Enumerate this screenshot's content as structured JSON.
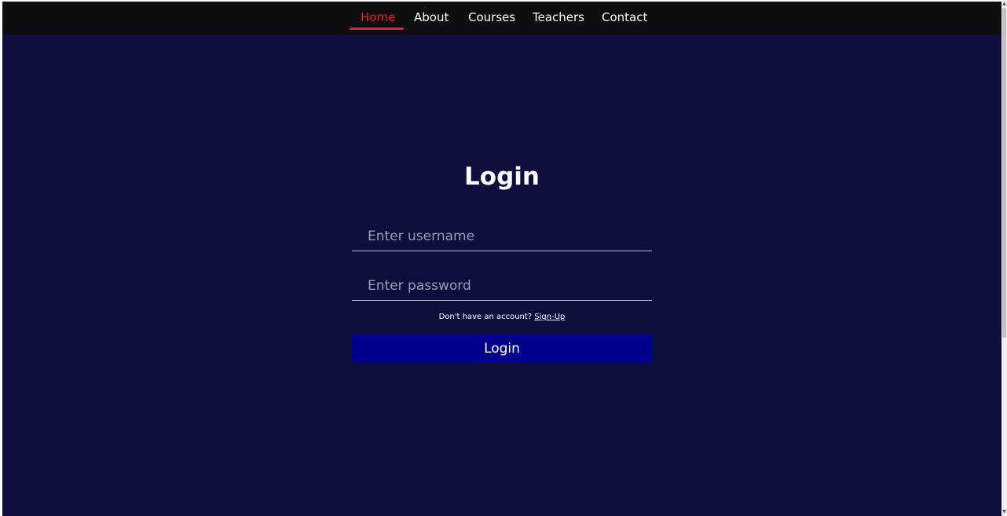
{
  "nav": {
    "items": [
      {
        "label": "Home",
        "active": true
      },
      {
        "label": "About",
        "active": false
      },
      {
        "label": "Courses",
        "active": false
      },
      {
        "label": "Teachers",
        "active": false
      },
      {
        "label": "Contact",
        "active": false
      }
    ]
  },
  "login": {
    "title": "Login",
    "username_placeholder": "Enter username",
    "username_value": "",
    "password_placeholder": "Enter password",
    "password_value": "",
    "signup_prompt": "Don't have an account?",
    "signup_link": "Sign-Up",
    "submit_label": "Login"
  },
  "colors": {
    "background": "#0d0d3e",
    "navbar": "#0e0e10",
    "active_nav": "#e0242c",
    "button": "#00008a",
    "text": "#ffffff"
  },
  "icons": {
    "scroll_up": "triangle-up-icon",
    "scroll_down": "triangle-down-icon"
  }
}
